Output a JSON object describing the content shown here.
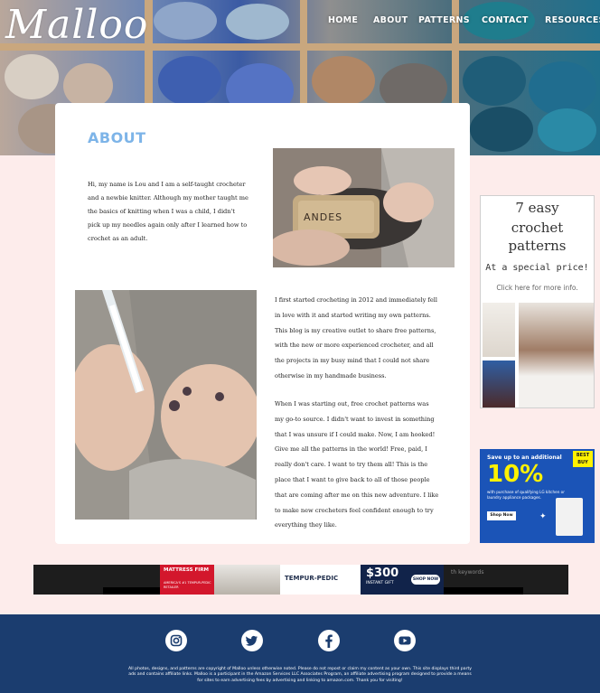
{
  "site": {
    "logo": "Malloo"
  },
  "nav": {
    "items": [
      {
        "label": "HOME"
      },
      {
        "label": "ABOUT"
      },
      {
        "label": "PATTERNS"
      },
      {
        "label": "CONTACT"
      },
      {
        "label": "RESOURCES"
      }
    ]
  },
  "main": {
    "title": "ABOUT",
    "intro": "Hi, my name is Lou and I am a self-taught crocheter and a newbie knitter. Although my mother taught me the basics of knitting when I was a child, I didn't pick up my needles again only after I learned how to crochet as an adult.",
    "paragraph1": "I first started crocheting in 2012 and immediately fell in love with it and started writing my own patterns. This blog is my creative outlet to share free patterns, with the new or more experienced crocheter, and all the projects in my busy mind that I could not share otherwise in my handmade business.",
    "paragraph2": "When I was starting out, free crochet patterns was my go-to source. I didn't want to invest in something that I was unsure if I could make. Now, I am hooked! Give me all the patterns in the world! Free, paid, I really don't care. I want to try them all! This is the place that I want to give back to all of those people that are coming after me on this new adventure. I like to make new crocheters feel confident enough to try everything they like.",
    "photo1_label": "ANDES"
  },
  "sidebar": {
    "ad1": {
      "line1": "7 easy",
      "line2": "crochet",
      "line3": "patterns",
      "line4": "At a special price!",
      "line5": "Click here for more info."
    },
    "ad2": {
      "headline": "Save up to an additional",
      "percent": "10%",
      "subtext": "with purchase of qualifying LG kitchen or laundry appliance packages.",
      "button": "Shop Now",
      "brand": "BEST BUY"
    }
  },
  "banner": {
    "brand": "MATTRESS FIRM",
    "tagline": "AMERICA'S #1 TEMPUR-PEDIC RETAILER",
    "product": "TEMPUR-PEDIC",
    "offer": "$300",
    "offer_sub": "INSTANT GIFT",
    "button": "SHOP NOW",
    "side_text": "th keywords"
  },
  "footer": {
    "social": [
      "instagram-icon",
      "twitter-icon",
      "facebook-icon",
      "youtube-icon"
    ],
    "disclaimer": "All photos, designs, and patterns are copyright of Malloo unless otherwise noted. Please do not repost or claim my content as your own. This site displays third party ads and contains affiliate links. Malloo is a participant in the Amazon Services LLC Associates Program, an affiliate advertising program designed to provide a means for sites to earn advertising fees by advertising and linking to amazon.com. Thank you for visiting!"
  },
  "colors": {
    "background": "#fdeceb",
    "accent": "#7db4e8",
    "footer": "#1b3d6f"
  }
}
